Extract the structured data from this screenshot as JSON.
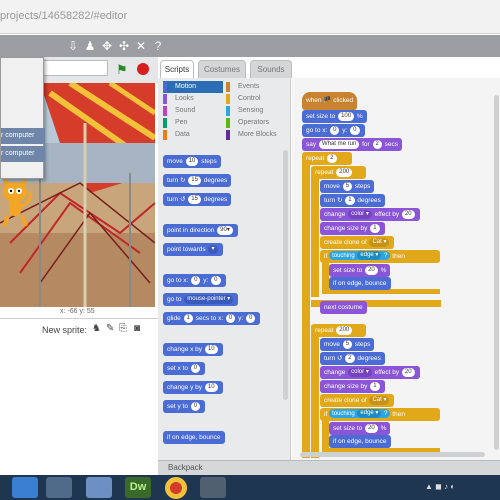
{
  "browser": {
    "url": "projects/14658282/#editor"
  },
  "menubar_icons": [
    "download-icon",
    "duplicate-icon",
    "expand-icon",
    "shrink-icon",
    "help-icon"
  ],
  "dropdown": {
    "items": [
      "r computer",
      "r computer"
    ]
  },
  "stage": {
    "coords": "x: -66   y: 55",
    "new_sprite_label": "New sprite:"
  },
  "tabs": [
    "Scripts",
    "Costumes",
    "Sounds"
  ],
  "categories": {
    "left": [
      {
        "label": "Motion",
        "color": "#4a6cd4",
        "selected": true
      },
      {
        "label": "Looks",
        "color": "#8a55d7"
      },
      {
        "label": "Sound",
        "color": "#bb42c3"
      },
      {
        "label": "Pen",
        "color": "#0e9a6c"
      },
      {
        "label": "Data",
        "color": "#ee7d16"
      }
    ],
    "right": [
      {
        "label": "Events",
        "color": "#c88330"
      },
      {
        "label": "Control",
        "color": "#e1a91a"
      },
      {
        "label": "Sensing",
        "color": "#2ca5e2"
      },
      {
        "label": "Operators",
        "color": "#5cb712"
      },
      {
        "label": "More Blocks",
        "color": "#632d99"
      }
    ]
  },
  "palette": {
    "move": {
      "pre": "move",
      "v": "10",
      "post": "steps"
    },
    "turn_right": {
      "pre": "turn",
      "v": "15",
      "post": "degrees"
    },
    "turn_left": {
      "pre": "turn",
      "v": "15",
      "post": "degrees"
    },
    "point_dir": {
      "pre": "point in direction",
      "v": "90▾"
    },
    "point_towards": {
      "pre": "point towards",
      "v": "▾"
    },
    "goto_xy": {
      "pre": "go to x:",
      "x": "0",
      "mid": "y:",
      "y": "0"
    },
    "goto": {
      "pre": "go to",
      "v": "mouse-pointer ▾"
    },
    "glide": {
      "pre": "glide",
      "s": "1",
      "mid": "secs to x:",
      "x": "0",
      "mid2": "y:",
      "y": "0"
    },
    "change_x": {
      "pre": "change x by",
      "v": "10"
    },
    "set_x": {
      "pre": "set x to",
      "v": "0"
    },
    "change_y": {
      "pre": "change y by",
      "v": "10"
    },
    "set_y": {
      "pre": "set y to",
      "v": "0"
    },
    "bounce": "if on edge, bounce"
  },
  "script": {
    "hat": "when 🏴 clicked",
    "set_size": {
      "pre": "set size to",
      "v": "100",
      "post": "%"
    },
    "goto": {
      "pre": "go to x:",
      "x": "0",
      "mid": "y:",
      "y": "0"
    },
    "say": {
      "pre": "say",
      "v": "What me run",
      "mid": "for",
      "s": "2",
      "post": "secs"
    },
    "repeat_outer": {
      "pre": "repeat",
      "v": "2"
    },
    "repeat_a": {
      "pre": "repeat",
      "v": "200"
    },
    "repeat_b": {
      "pre": "repeat",
      "v": "200"
    },
    "a_move": {
      "pre": "move",
      "v": "5",
      "post": "steps"
    },
    "a_turn": {
      "pre": "turn",
      "v": "1",
      "post": "degrees"
    },
    "a_effect": {
      "pre": "change",
      "v": "color ▾",
      "mid": "effect by",
      "n": "20"
    },
    "a_size": {
      "pre": "change size by",
      "v": "1"
    },
    "a_clone": {
      "pre": "create clone of",
      "v": "Cat ▾"
    },
    "a_if": {
      "pre": "if",
      "sense": "touching",
      "v": "edge ▾",
      "q": "?",
      "post": "then"
    },
    "a_setsize": {
      "pre": "set size to",
      "v": "20",
      "post": "%"
    },
    "a_bounce": "if on edge, bounce",
    "next_costume": "next costume",
    "b_move": {
      "pre": "move",
      "v": "5",
      "post": "steps"
    },
    "b_turn": {
      "pre": "turn",
      "v": "2",
      "post": "degrees"
    },
    "b_effect": {
      "pre": "change",
      "v": "color ▾",
      "mid": "effect by",
      "n": "20"
    },
    "b_size": {
      "pre": "change size by",
      "v": "1"
    },
    "b_clone": {
      "pre": "create clone of",
      "v": "Cat ▾"
    },
    "b_if": {
      "pre": "if",
      "sense": "touching",
      "v": "edge ▾",
      "q": "?",
      "post": "then"
    },
    "b_setsize": {
      "pre": "set size to",
      "v": "20",
      "post": "%"
    },
    "b_bounce": "if on edge, bounce"
  },
  "backpack": "Backpack",
  "taskbar": {
    "apps": [
      {
        "name": "start-button",
        "color": "#3b7fd0"
      },
      {
        "name": "file-explorer",
        "color": "#e2b23a"
      },
      {
        "name": "app-circle",
        "color": "#4a7ab8"
      },
      {
        "name": "app-paint",
        "color": "#6c8fc4"
      },
      {
        "name": "dreamweaver",
        "color": "#3a6a2a",
        "label": "Dw"
      },
      {
        "name": "chrome",
        "color": "#d33b2c"
      },
      {
        "name": "app-window",
        "color": "#506070"
      }
    ]
  }
}
